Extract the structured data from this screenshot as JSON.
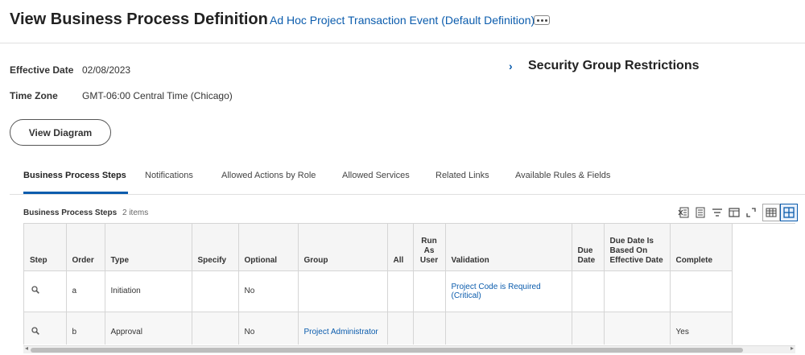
{
  "header": {
    "title": "View Business Process Definition",
    "subtitle": "Ad Hoc Project Transaction Event (Default Definition)"
  },
  "fields": {
    "effective_date_label": "Effective Date",
    "effective_date_value": "02/08/2023",
    "time_zone_label": "Time Zone",
    "time_zone_value": "GMT-06:00 Central Time (Chicago)"
  },
  "security": {
    "title": "Security Group Restrictions",
    "expanded": false
  },
  "buttons": {
    "view_diagram": "View Diagram"
  },
  "tabs": [
    {
      "label": "Business Process Steps",
      "active": true
    },
    {
      "label": "Notifications",
      "active": false
    },
    {
      "label": "Allowed Actions by Role",
      "active": false
    },
    {
      "label": "Allowed Services",
      "active": false
    },
    {
      "label": "Related Links",
      "active": false
    },
    {
      "label": "Available Rules & Fields",
      "active": false
    }
  ],
  "grid": {
    "title": "Business Process Steps",
    "count": "2 items",
    "toolbar_icons": [
      "export-excel-icon",
      "print-icon",
      "filter-icon",
      "columns-icon",
      "fullscreen-icon",
      "table-view-icon",
      "grid-view-icon"
    ],
    "columns": [
      "Step",
      "Order",
      "Type",
      "Specify",
      "Optional",
      "Group",
      "All",
      "Run As User",
      "Validation",
      "Due Date",
      "Due Date Is Based On Effective Date",
      "Complete"
    ],
    "rows": [
      {
        "step_icon": "search-icon",
        "order": "a",
        "type": "Initiation",
        "specify": "",
        "optional": "No",
        "group": "",
        "all": "",
        "run_as_user": "",
        "validation": "Project Code is Required (Critical)",
        "due_date": "",
        "due_date_based": "",
        "complete": ""
      },
      {
        "step_icon": "search-icon",
        "order": "b",
        "type": "Approval",
        "specify": "",
        "optional": "No",
        "group": "Project Administrator",
        "all": "",
        "run_as_user": "",
        "validation": "",
        "due_date": "",
        "due_date_based": "",
        "complete": "Yes"
      }
    ]
  },
  "colors": {
    "accent": "#0b5cad",
    "border": "#d5d5d5",
    "header_bg": "#f5f5f5"
  }
}
